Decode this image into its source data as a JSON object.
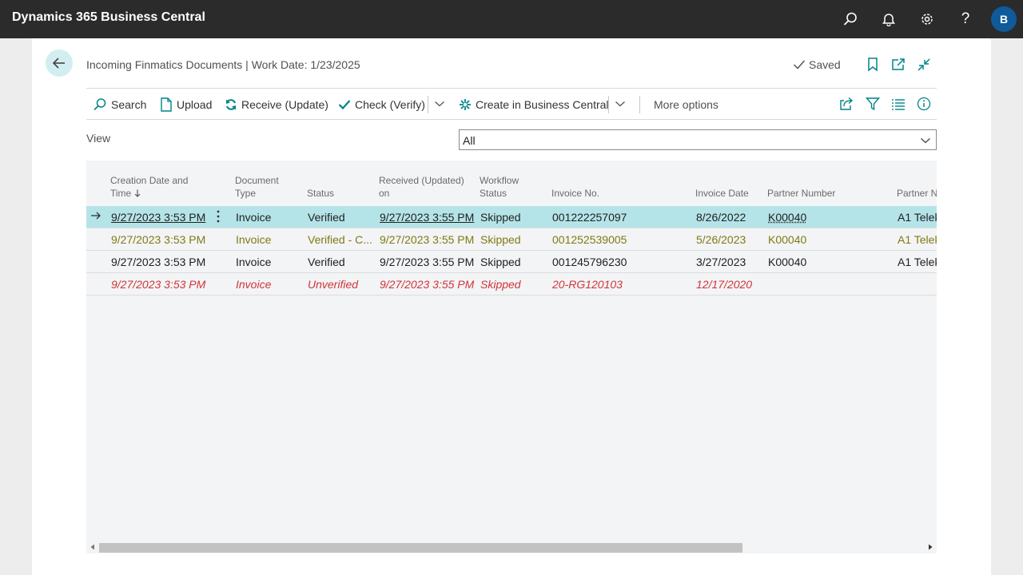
{
  "app": {
    "title": "Dynamics 365 Business Central",
    "avatar_letter": "B"
  },
  "header": {
    "title": "Incoming Finmatics Documents | Work Date: 1/23/2025",
    "saved_label": "Saved"
  },
  "actions": {
    "search": "Search",
    "upload": "Upload",
    "receive": "Receive (Update)",
    "check": "Check (Verify)",
    "create": "Create in Business Central",
    "more": "More options"
  },
  "view": {
    "label": "View",
    "value": "All"
  },
  "columns": {
    "creation_l1": "Creation Date and",
    "creation_l2": "Time",
    "doctype_l1": "Document",
    "doctype_l2": "Type",
    "status": "Status",
    "received_l1": "Received (Updated)",
    "received_l2": "on",
    "workflow_l1": "Workflow",
    "workflow_l2": "Status",
    "invoice_no": "Invoice No.",
    "invoice_date": "Invoice Date",
    "partner_number": "Partner Number",
    "partner_name": "Partner N"
  },
  "rows": [
    {
      "created": "9/27/2023 3:53 PM",
      "doctype": "Invoice",
      "status": "Verified",
      "received": "9/27/2023 3:55 PM",
      "workflow": "Skipped",
      "invoice_no": "001222257097",
      "invoice_date": "8/26/2022",
      "partner_number": "K00040",
      "partner_name": "A1 Telek"
    },
    {
      "created": "9/27/2023 3:53 PM",
      "doctype": "Invoice",
      "status": "Verified - C...",
      "received": "9/27/2023 3:55 PM",
      "workflow": "Skipped",
      "invoice_no": "001252539005",
      "invoice_date": "5/26/2023",
      "partner_number": "K00040",
      "partner_name": "A1 Telek"
    },
    {
      "created": "9/27/2023 3:53 PM",
      "doctype": "Invoice",
      "status": "Verified",
      "received": "9/27/2023 3:55 PM",
      "workflow": "Skipped",
      "invoice_no": "001245796230",
      "invoice_date": "3/27/2023",
      "partner_number": "K00040",
      "partner_name": "A1 Telek"
    },
    {
      "created": "9/27/2023 3:53 PM",
      "doctype": "Invoice",
      "status": "Unverified",
      "received": "9/27/2023 3:55 PM",
      "workflow": "Skipped",
      "invoice_no": "20-RG120103",
      "invoice_date": "12/17/2020",
      "partner_number": "",
      "partner_name": ""
    }
  ],
  "colors": {
    "accent": "#008489",
    "selected_row": "#b4e4e8",
    "warning_text": "#7f7a12",
    "error_text": "#d13438",
    "topbar": "#2b2b2b",
    "avatar": "#0e5a9b"
  },
  "icons": [
    "search-icon",
    "bell-icon",
    "gear-icon",
    "help-icon",
    "back-arrow-icon",
    "checkmark-icon",
    "bookmark-icon",
    "open-new-window-icon",
    "collapse-icon",
    "upload-icon",
    "refresh-icon",
    "sparkle-icon",
    "share-icon",
    "filter-icon",
    "list-icon",
    "info-icon",
    "row-arrow-icon",
    "ellipsis-icon",
    "sort-down-icon",
    "chevron-down-icon"
  ]
}
